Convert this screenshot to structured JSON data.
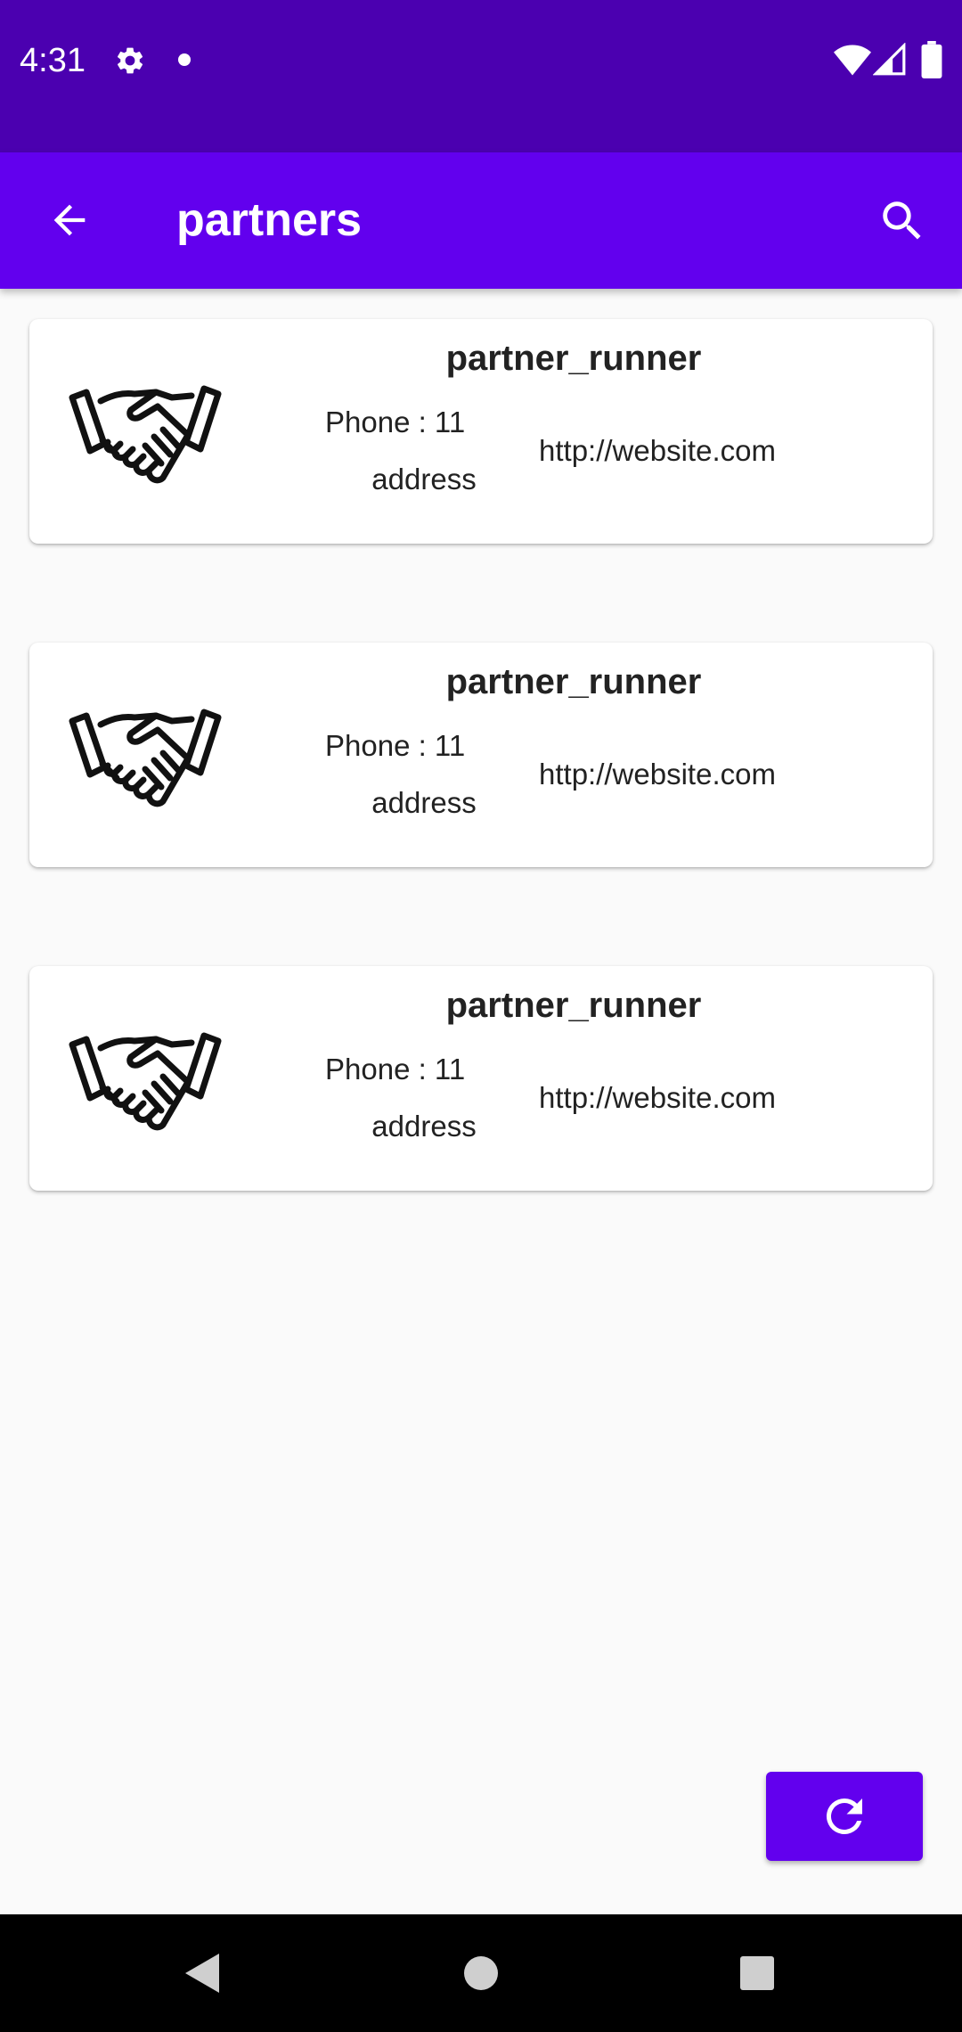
{
  "status_bar": {
    "time": "4:31",
    "icons": [
      "gear-icon",
      "notification-dot-icon",
      "wifi-icon",
      "signal-icon",
      "battery-icon"
    ]
  },
  "app_bar": {
    "title": "partners",
    "back_icon": "arrow-back-icon",
    "search_icon": "search-icon",
    "color": "#6200ee"
  },
  "partners": [
    {
      "name": "partner_runner",
      "phone": "Phone : 11",
      "address": "address",
      "website": "http://website.com",
      "icon": "handshake-icon"
    },
    {
      "name": "partner_runner",
      "phone": "Phone : 11",
      "address": "address",
      "website": "http://website.com",
      "icon": "handshake-icon"
    },
    {
      "name": "partner_runner",
      "phone": "Phone : 11",
      "address": "address",
      "website": "http://website.com",
      "icon": "handshake-icon"
    }
  ],
  "fab": {
    "icon": "refresh-icon",
    "color": "#6200ee"
  },
  "nav_bar": {
    "icons": [
      "nav-back-icon",
      "nav-home-icon",
      "nav-recents-icon"
    ]
  },
  "colors": {
    "status_bar": "#4b00b0",
    "primary": "#6200ee",
    "background": "#fafafa",
    "card": "#ffffff",
    "text": "#222222"
  }
}
